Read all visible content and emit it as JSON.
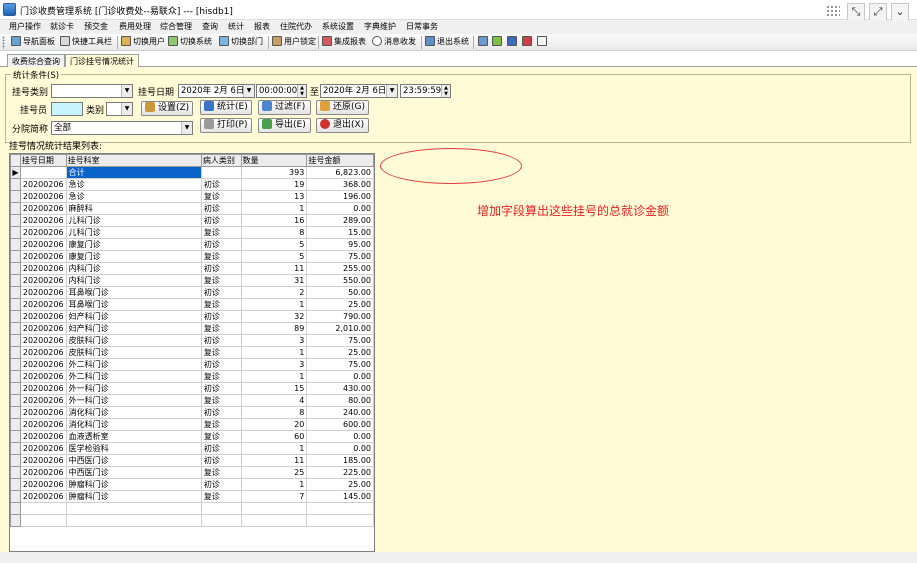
{
  "window": {
    "title": "门诊收费管理系统 [门诊收费处--易联众] --- [hisdb1]"
  },
  "menu": [
    "用户操作",
    "就诊卡",
    "预交金",
    "费用处理",
    "综合管理",
    "查询",
    "统计",
    "报表",
    "住院代办",
    "系统设置",
    "字典维护",
    "日常事务"
  ],
  "toolbar": {
    "nav_panel": "导航面板",
    "quick_toolbar": "快捷工具栏",
    "switch_user": "切换用户",
    "switch_system": "切换系统",
    "switch_dept": "切换部门",
    "user_lock": "用户锁定",
    "integrated_report": "集成报表",
    "messages": "消息收发",
    "exit_system": "退出系统"
  },
  "tabs": [
    "收费综合查询",
    "门诊挂号情况统计"
  ],
  "stats": {
    "group_title": "统计条件(S)",
    "reg_type_label": "挂号类别",
    "reg_type_value": "",
    "reg_date_label": "挂号日期",
    "date_from": "2020年 2月 6日",
    "time_from": "00:00:00",
    "to_label": "至",
    "date_to": "2020年 2月 6日",
    "time_to": "23:59:59",
    "registrar_label": "挂号员",
    "category_label": "类别",
    "category_value": "",
    "branch_label": "分院简称",
    "branch_value": "全部",
    "btn_settings": "设置(Z)",
    "btn_stats": "统计(E)",
    "btn_filter": "过滤(F)",
    "btn_restore": "还原(G)",
    "btn_print": "打印(P)",
    "btn_export": "导出(E)",
    "btn_exit": "退出(X)"
  },
  "results_label": "挂号情况统计结果列表:",
  "table": {
    "columns": [
      "挂号日期",
      "挂号科室",
      "病人类别",
      "数量",
      "挂号金额"
    ],
    "summary": {
      "label": "合计",
      "count": "393",
      "amount": "6,823.00"
    },
    "rows": [
      [
        "20200206",
        "急诊",
        "初诊",
        "19",
        "368.00"
      ],
      [
        "20200206",
        "急诊",
        "复诊",
        "13",
        "196.00"
      ],
      [
        "20200206",
        "麻醉科",
        "初诊",
        "1",
        "0.00"
      ],
      [
        "20200206",
        "儿科门诊",
        "初诊",
        "16",
        "289.00"
      ],
      [
        "20200206",
        "儿科门诊",
        "复诊",
        "8",
        "15.00"
      ],
      [
        "20200206",
        "康复门诊",
        "初诊",
        "5",
        "95.00"
      ],
      [
        "20200206",
        "康复门诊",
        "复诊",
        "5",
        "75.00"
      ],
      [
        "20200206",
        "内科门诊",
        "初诊",
        "11",
        "255.00"
      ],
      [
        "20200206",
        "内科门诊",
        "复诊",
        "31",
        "550.00"
      ],
      [
        "20200206",
        "耳鼻喉门诊",
        "初诊",
        "2",
        "50.00"
      ],
      [
        "20200206",
        "耳鼻喉门诊",
        "复诊",
        "1",
        "25.00"
      ],
      [
        "20200206",
        "妇产科门诊",
        "初诊",
        "32",
        "790.00"
      ],
      [
        "20200206",
        "妇产科门诊",
        "复诊",
        "89",
        "2,010.00"
      ],
      [
        "20200206",
        "皮肤科门诊",
        "初诊",
        "3",
        "75.00"
      ],
      [
        "20200206",
        "皮肤科门诊",
        "复诊",
        "1",
        "25.00"
      ],
      [
        "20200206",
        "外二科门诊",
        "初诊",
        "3",
        "75.00"
      ],
      [
        "20200206",
        "外二科门诊",
        "复诊",
        "1",
        "0.00"
      ],
      [
        "20200206",
        "外一科门诊",
        "初诊",
        "15",
        "430.00"
      ],
      [
        "20200206",
        "外一科门诊",
        "复诊",
        "4",
        "80.00"
      ],
      [
        "20200206",
        "消化科门诊",
        "初诊",
        "8",
        "240.00"
      ],
      [
        "20200206",
        "消化科门诊",
        "复诊",
        "20",
        "600.00"
      ],
      [
        "20200206",
        "血液透析室",
        "复诊",
        "60",
        "0.00"
      ],
      [
        "20200206",
        "医学检验科",
        "初诊",
        "1",
        "0.00"
      ],
      [
        "20200206",
        "中西医门诊",
        "初诊",
        "11",
        "185.00"
      ],
      [
        "20200206",
        "中西医门诊",
        "复诊",
        "25",
        "225.00"
      ],
      [
        "20200206",
        "肿瘤科门诊",
        "初诊",
        "1",
        "25.00"
      ],
      [
        "20200206",
        "肿瘤科门诊",
        "复诊",
        "7",
        "145.00"
      ]
    ],
    "empty_rows": 2
  },
  "annotation": "增加字段算出这些挂号的总就诊金额",
  "colors": {
    "panel_bg": "#fffbd6",
    "selection": "#0a63c9",
    "annotation": "#e32222"
  }
}
